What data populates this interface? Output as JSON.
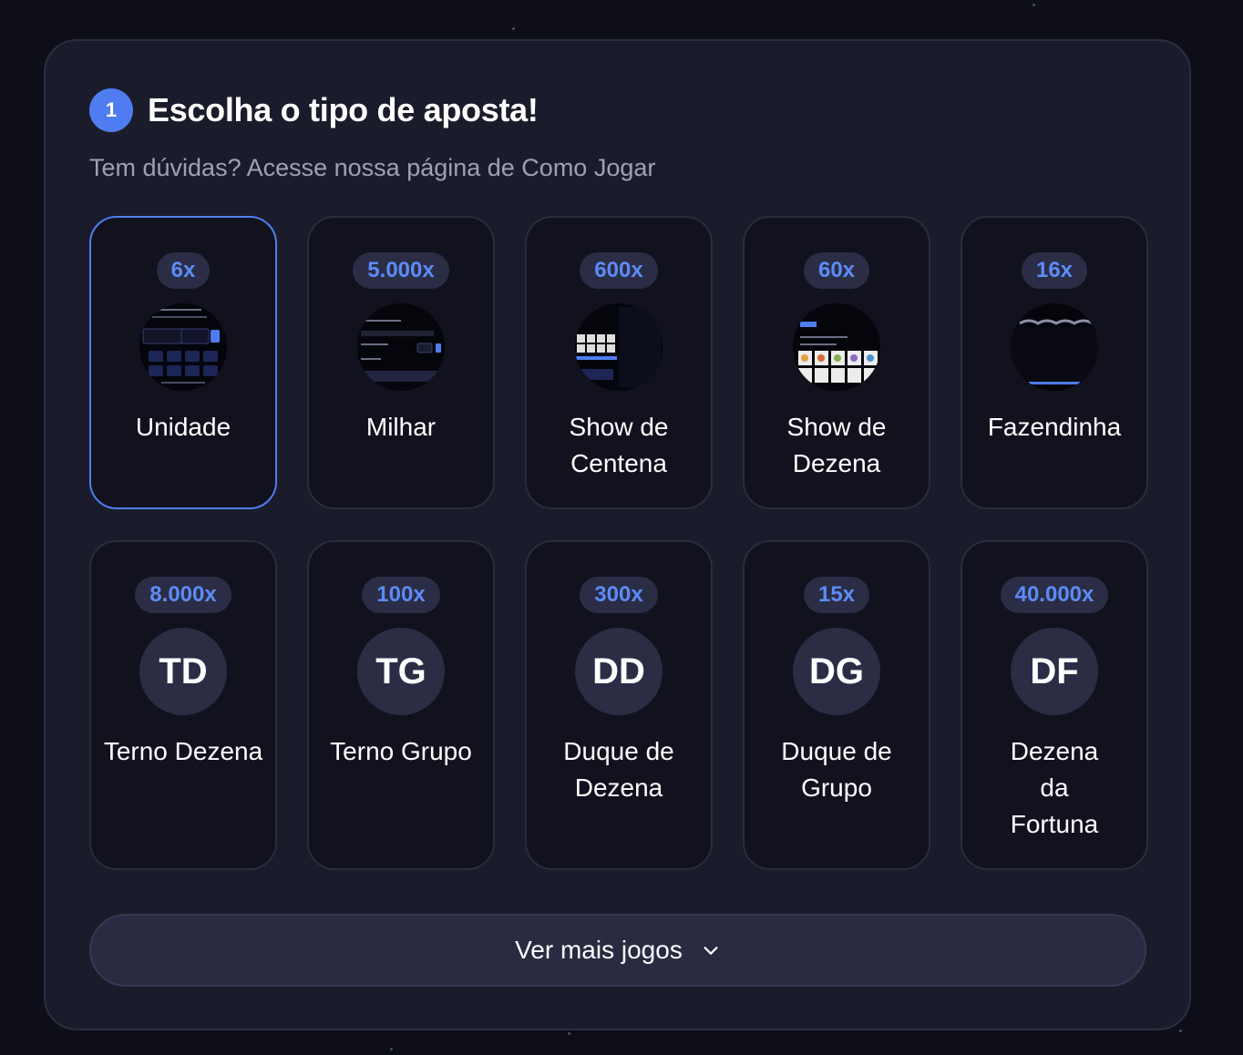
{
  "header": {
    "step_number": "1",
    "title": "Escolha o tipo de aposta!",
    "subtitle": "Tem dúvidas? Acesse nossa página de Como Jogar"
  },
  "bet_types": [
    {
      "multiplier": "6x",
      "name": "Unidade",
      "thumbnail": "screenshot-thumbnail",
      "selected": true
    },
    {
      "multiplier": "5.000x",
      "name": "Milhar",
      "thumbnail": "screenshot-thumbnail"
    },
    {
      "multiplier": "600x",
      "name": "Show de Centena",
      "thumbnail": "screenshot-thumbnail"
    },
    {
      "multiplier": "60x",
      "name": "Show de Dezena",
      "thumbnail": "screenshot-thumbnail"
    },
    {
      "multiplier": "16x",
      "name": "Fazendinha",
      "thumbnail": "screenshot-thumbnail"
    },
    {
      "multiplier": "8.000x",
      "abbr": "TD",
      "name": "Terno Dezena"
    },
    {
      "multiplier": "100x",
      "abbr": "TG",
      "name": "Terno Grupo"
    },
    {
      "multiplier": "300x",
      "abbr": "DD",
      "name": "Duque de Dezena"
    },
    {
      "multiplier": "15x",
      "abbr": "DG",
      "name": "Duque de Grupo"
    },
    {
      "multiplier": "40.000x",
      "abbr": "DF",
      "name": "Dezena da Fortuna"
    }
  ],
  "footer": {
    "more_label": "Ver mais jogos",
    "more_icon": "chevron-down-icon"
  },
  "colors": {
    "accent": "#4f7df1",
    "multiplier_text": "#5d8bf6",
    "card_bg": "#11121d",
    "panel_bg": "#1b1c2b"
  }
}
